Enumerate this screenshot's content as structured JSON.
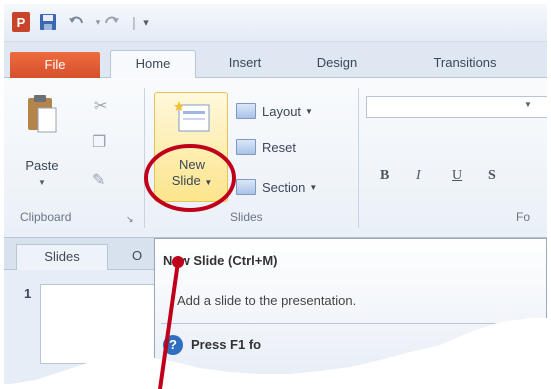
{
  "qat": {
    "app_icon": "P",
    "icons": [
      "powerpoint-logo",
      "save-icon",
      "undo-icon",
      "redo-icon",
      "customize-qat-icon"
    ]
  },
  "tabs": {
    "file": "File",
    "home": "Home",
    "insert": "Insert",
    "design": "Design",
    "transitions": "Transitions"
  },
  "ribbon": {
    "clipboard": {
      "paste": "Paste",
      "group_label": "Clipboard"
    },
    "slides": {
      "new_slide_line1": "New",
      "new_slide_line2": "Slide",
      "layout": "Layout",
      "reset": "Reset",
      "section": "Section",
      "group_label": "Slides"
    },
    "font": {
      "bold": "B",
      "italic": "I",
      "underline": "U",
      "shadow": "S",
      "group_label": "Fo"
    }
  },
  "pane": {
    "slides_tab": "Slides",
    "outline_tab": "O",
    "slide_number": "1"
  },
  "tooltip": {
    "title": "New Slide (Ctrl+M)",
    "description": "Add a slide to the presentation.",
    "help_icon": "?",
    "help_text": "Press F1 fo"
  },
  "colors": {
    "file_tab": "#d5512c",
    "highlight": "#fce58c",
    "annotation": "#c0001a"
  }
}
